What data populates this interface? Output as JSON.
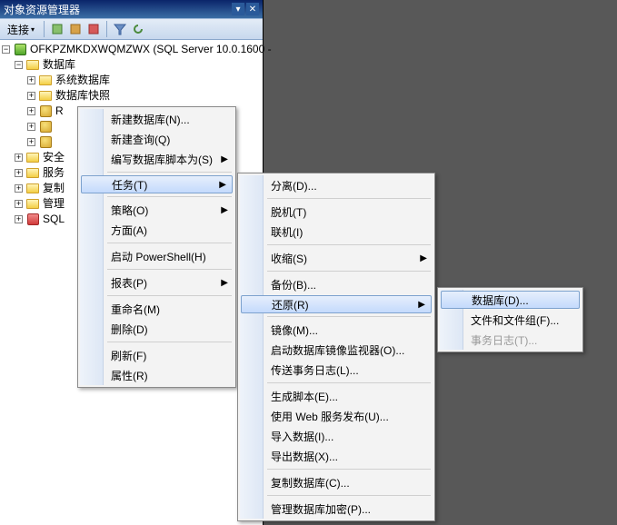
{
  "panel": {
    "title": "对象资源管理器",
    "toolbar": {
      "connect": "连接"
    },
    "tree": {
      "root": "OFKPZMKDXWQMZWX (SQL Server 10.0.1600 -",
      "databases": "数据库",
      "sysdb": "系统数据库",
      "snapshots": "数据库快照",
      "dbitem": "R",
      "security": "安全",
      "servobj": "服务",
      "replication": "复制",
      "management": "管理",
      "sqlagent": "SQL"
    }
  },
  "menu1": {
    "newdb": "新建数据库(N)...",
    "newquery": "新建查询(Q)",
    "scriptas": "编写数据库脚本为(S)",
    "tasks": "任务(T)",
    "policies": "策略(O)",
    "facets": "方面(A)",
    "powershell": "启动 PowerShell(H)",
    "reports": "报表(P)",
    "rename": "重命名(M)",
    "delete": "删除(D)",
    "refresh": "刷新(F)",
    "properties": "属性(R)"
  },
  "menu2": {
    "detach": "分离(D)...",
    "offline": "脱机(T)",
    "online": "联机(I)",
    "shrink": "收缩(S)",
    "backup": "备份(B)...",
    "restore": "还原(R)",
    "mirror": "镜像(M)...",
    "launchmonitor": "启动数据库镜像监视器(O)...",
    "shiplogs": "传送事务日志(L)...",
    "genscripts": "生成脚本(E)...",
    "webpublish": "使用 Web 服务发布(U)...",
    "importdata": "导入数据(I)...",
    "exportdata": "导出数据(X)...",
    "copydb": "复制数据库(C)...",
    "manageenc": "管理数据库加密(P)..."
  },
  "menu3": {
    "database": "数据库(D)...",
    "filesgroups": "文件和文件组(F)...",
    "txlog": "事务日志(T)..."
  }
}
